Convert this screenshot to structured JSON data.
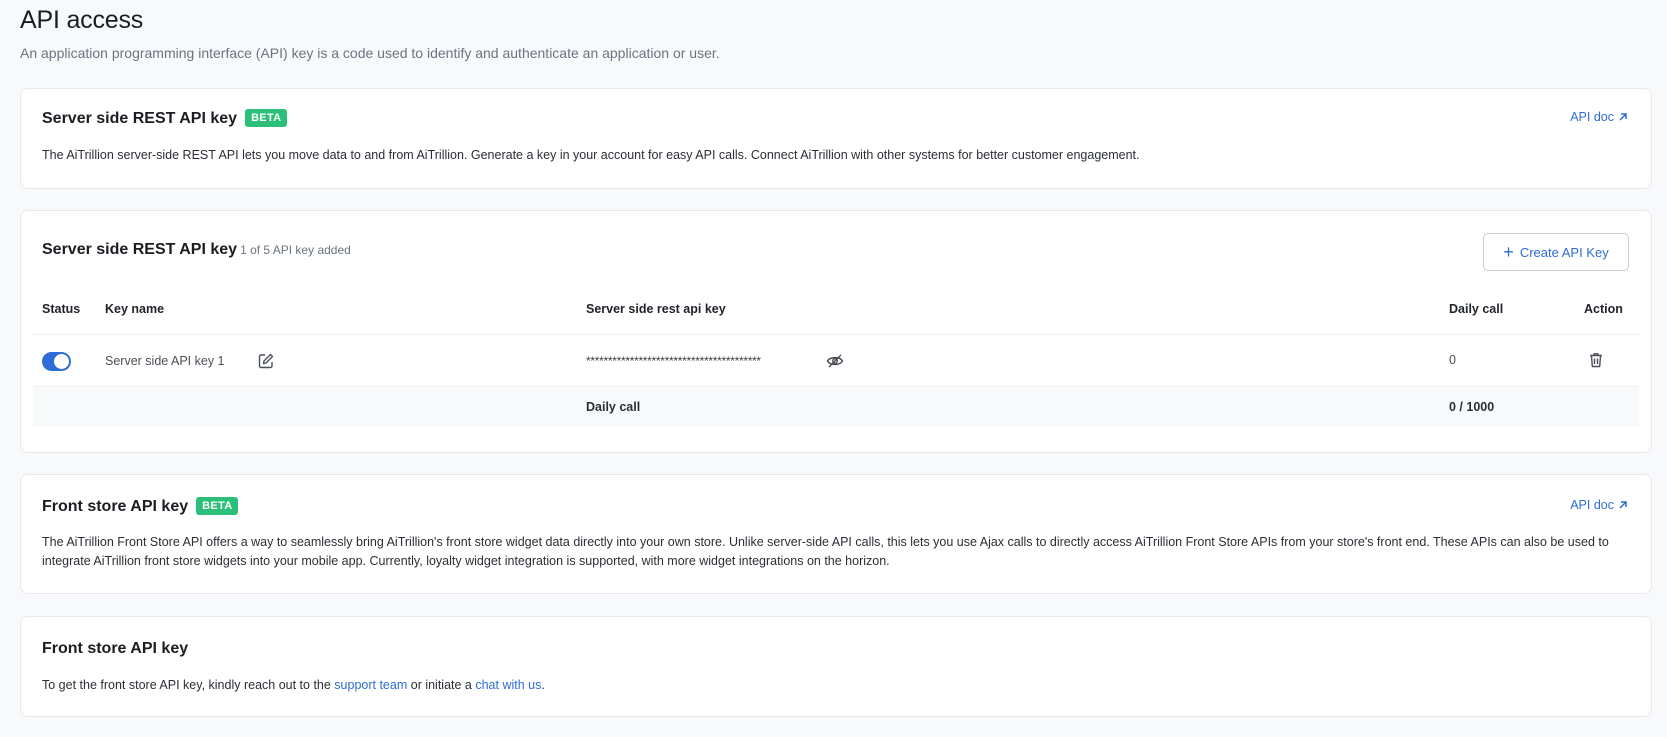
{
  "header": {
    "title": "API access",
    "subtitle": "An application programming interface (API) key is a code used to identify and authenticate an application or user."
  },
  "rest_info": {
    "title": "Server side REST API key",
    "badge": "BETA",
    "api_doc": "API doc",
    "description": "The AiTrillion server-side REST API lets you move data to and from AiTrillion. Generate a key in your account for easy API calls. Connect AiTrillion with other systems for better customer engagement."
  },
  "rest_keys": {
    "title": "Server side REST API key",
    "count": "1 of 5 API key added",
    "create_label": "Create API Key",
    "columns": {
      "status": "Status",
      "key_name": "Key name",
      "api_key": "Server side rest api key",
      "daily_call": "Daily call",
      "action": "Action"
    },
    "rows": [
      {
        "enabled": true,
        "key_name": "Server side API key 1",
        "masked_key": "****************************************",
        "daily_call": "0"
      }
    ],
    "footer": {
      "label": "Daily call",
      "value": "0 / 1000"
    }
  },
  "front_info": {
    "title": "Front store API key",
    "badge": "BETA",
    "api_doc": "API doc",
    "description": "The AiTrillion Front Store API offers a way to seamlessly bring AiTrillion's front store widget data directly into your own store. Unlike server-side API calls, this lets you use Ajax calls to directly access AiTrillion Front Store APIs from your store's front end. These APIs can also be used to integrate AiTrillion front store widgets into your mobile app. Currently, loyalty widget integration is supported, with more widget integrations on the horizon."
  },
  "front_key": {
    "title": "Front store API key",
    "text_before": "To get the front store API key, kindly reach out to the ",
    "support_link": "support team",
    "text_middle": " or initiate a ",
    "chat_link": "chat with us",
    "text_after": "."
  },
  "colors": {
    "accent": "#2e6cd6",
    "badge": "#2bbf7a"
  }
}
